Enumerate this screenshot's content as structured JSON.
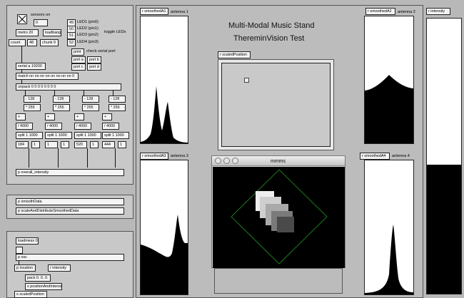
{
  "left_patch": {
    "sensors_label": "sensors on",
    "sensors_value": "0",
    "metro": "metro 20",
    "loadbang": "loadbang",
    "count": "count",
    "count_max": "48",
    "chunk": "chunk 9",
    "toggle_label": "toggle LEDs",
    "led_values": [
      "49",
      "50",
      "51",
      "52"
    ],
    "led_labels": [
      "LED1 (pin0)",
      "LED2 (pin1)",
      "LED3 (pin2)",
      "LED4 (pin3)"
    ],
    "print": "print",
    "check_label": "check serial port",
    "ports": [
      "port a",
      "port b",
      "port c",
      "port d"
    ],
    "serial": "serial a 19200",
    "match": "match nn nn nn nn nn nn nn nn 0",
    "unpack": "unpack 0 0 0 0 0 0 0 0",
    "minus": [
      "- 128",
      "- 128",
      "- 128",
      "- 128"
    ],
    "times": [
      "* 255",
      "* 255",
      "* 255",
      "* 255"
    ],
    "plus": [
      "+",
      "+",
      "+",
      "+"
    ],
    "div": [
      "/ 4000",
      "/ 4000",
      "/ 4000",
      "/ 4000"
    ],
    "split": [
      "split 1 1000",
      "split 1 1000",
      "split 1 1000",
      "split 1 1000"
    ],
    "nums": [
      "184",
      "1",
      "520",
      "444"
    ],
    "ones": [
      "1",
      "1",
      "1",
      "1"
    ],
    "overall": "p overall_intensity"
  },
  "mid_patch": {
    "smooth": "p smoothData",
    "scale": "p scaleAndDistributeSmoothedData"
  },
  "bottom_patch": {
    "loadmess": "loadmess 0",
    "osc": "p osc",
    "location": "p location",
    "r_intensity": "r intensity",
    "pack": "pack 0. 0. 0.",
    "pos_intensity": "s positionAndIntensity",
    "s_scaled": "s scaledPosition"
  },
  "main": {
    "title_line1": "Multi-Modal Music Stand",
    "title_line2": "ThereminVision Test",
    "antennas": {
      "a1": {
        "receive": "r smoothedA1",
        "label": "antenna 1"
      },
      "a2": {
        "receive": "r smoothedA2",
        "label": "antenna 2"
      },
      "a3": {
        "receive": "r smoothedA3",
        "label": "antenna 3"
      },
      "a4": {
        "receive": "r smoothedA4",
        "label": "antenna 4"
      }
    },
    "scaled_position": "r scaledPosition",
    "intensity": "r intensity",
    "intensity_level": 0.47
  },
  "jitter_window": {
    "title": "mmms"
  },
  "colors": {
    "background": "#b8b8b8",
    "panel": "#c8c8c8",
    "plot_fill": "#000000",
    "diamond": "#1a7a1a"
  }
}
